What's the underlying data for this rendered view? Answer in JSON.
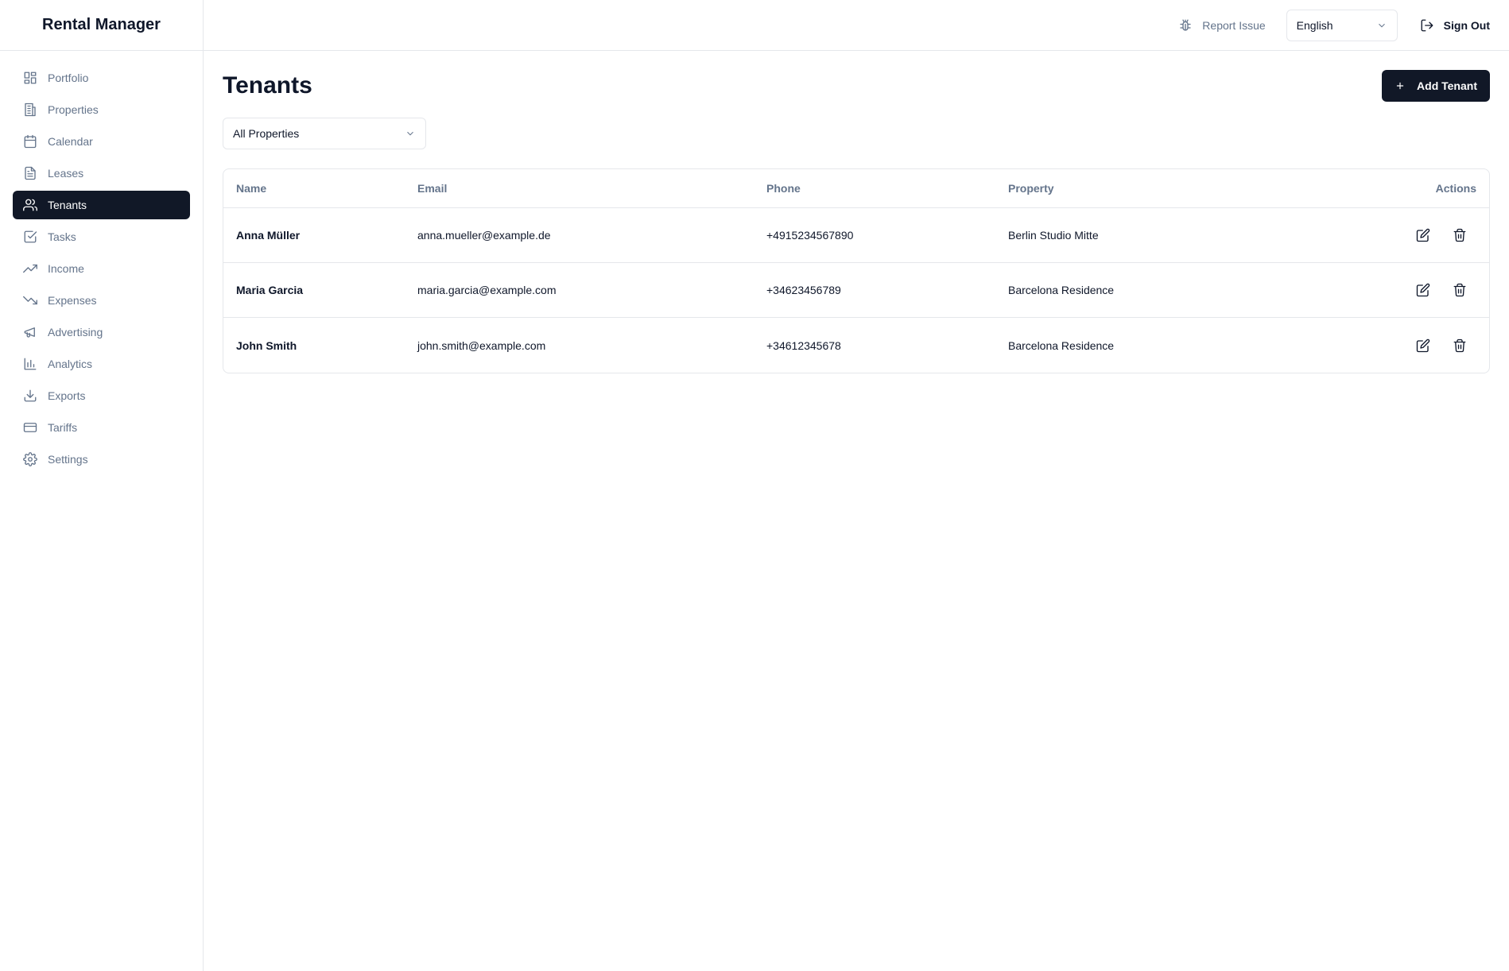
{
  "app": {
    "title": "Rental Manager"
  },
  "sidebar": {
    "items": [
      {
        "label": "Portfolio",
        "icon": "grid-icon"
      },
      {
        "label": "Properties",
        "icon": "building-icon"
      },
      {
        "label": "Calendar",
        "icon": "calendar-icon"
      },
      {
        "label": "Leases",
        "icon": "document-icon"
      },
      {
        "label": "Tenants",
        "icon": "users-icon",
        "active": true
      },
      {
        "label": "Tasks",
        "icon": "checkbox-icon"
      },
      {
        "label": "Income",
        "icon": "trending-up-icon"
      },
      {
        "label": "Expenses",
        "icon": "trending-down-icon"
      },
      {
        "label": "Advertising",
        "icon": "megaphone-icon"
      },
      {
        "label": "Analytics",
        "icon": "bar-chart-icon"
      },
      {
        "label": "Exports",
        "icon": "download-icon"
      },
      {
        "label": "Tariffs",
        "icon": "credit-card-icon"
      },
      {
        "label": "Settings",
        "icon": "gear-icon"
      }
    ]
  },
  "header": {
    "report_issue": "Report Issue",
    "language": "English",
    "sign_out": "Sign Out"
  },
  "main": {
    "title": "Tenants",
    "add_button": "Add Tenant",
    "filter": "All Properties",
    "table": {
      "columns": {
        "name": "Name",
        "email": "Email",
        "phone": "Phone",
        "property": "Property",
        "actions": "Actions"
      },
      "rows": [
        {
          "name": "Anna Müller",
          "email": "anna.mueller@example.de",
          "phone": "+4915234567890",
          "property": "Berlin Studio Mitte"
        },
        {
          "name": "Maria Garcia",
          "email": "maria.garcia@example.com",
          "phone": "+34623456789",
          "property": "Barcelona Residence"
        },
        {
          "name": "John Smith",
          "email": "john.smith@example.com",
          "phone": "+34612345678",
          "property": "Barcelona Residence"
        }
      ]
    }
  },
  "colors": {
    "primary": "#111827",
    "muted": "#64748b",
    "border": "#e5e7eb"
  }
}
